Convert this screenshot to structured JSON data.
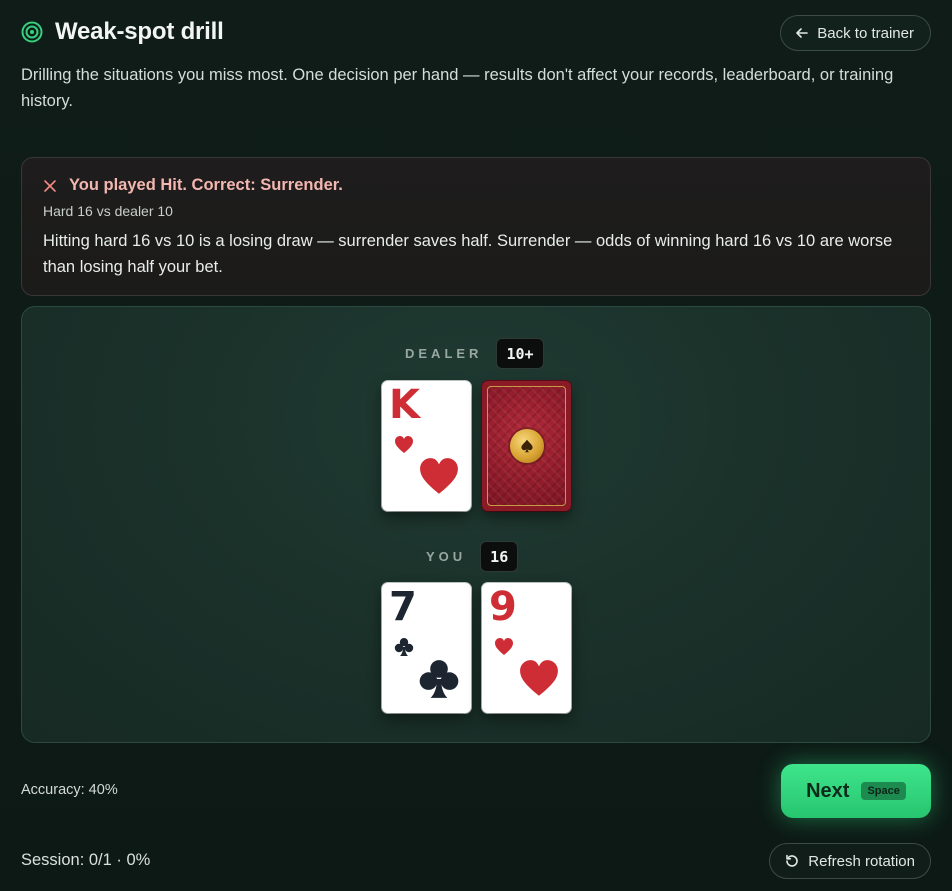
{
  "header": {
    "title": "Weak-spot drill",
    "subtitle": "Drilling the situations you miss most. One decision per hand — results don't affect your records, leaderboard, or training history.",
    "back_label": "Back to trainer"
  },
  "feedback": {
    "title": "You played Hit. Correct: Surrender.",
    "situation": "Hard 16 vs dealer 10",
    "explanation": "Hitting hard 16 vs 10 is a losing draw — surrender saves half. Surrender — odds of winning hard 16 vs 10 are worse than losing half your bet.",
    "color": "#f3b6b0"
  },
  "dealer": {
    "label": "DEALER",
    "total": "10+",
    "cards": [
      {
        "rank": "K",
        "suit": "hearts",
        "color": "red"
      },
      {
        "face_down": true,
        "back_color": "#8a1a26"
      }
    ]
  },
  "player": {
    "label": "YOU",
    "total": "16",
    "cards": [
      {
        "rank": "7",
        "suit": "clubs",
        "color": "black"
      },
      {
        "rank": "9",
        "suit": "hearts",
        "color": "red"
      }
    ]
  },
  "footer": {
    "accuracy": "Accuracy: 40%",
    "next_label": "Next",
    "next_shortcut": "Space",
    "session": "Session: 0/1 · 0%",
    "refresh_label": "Refresh rotation",
    "accent": "#3ee58b"
  }
}
